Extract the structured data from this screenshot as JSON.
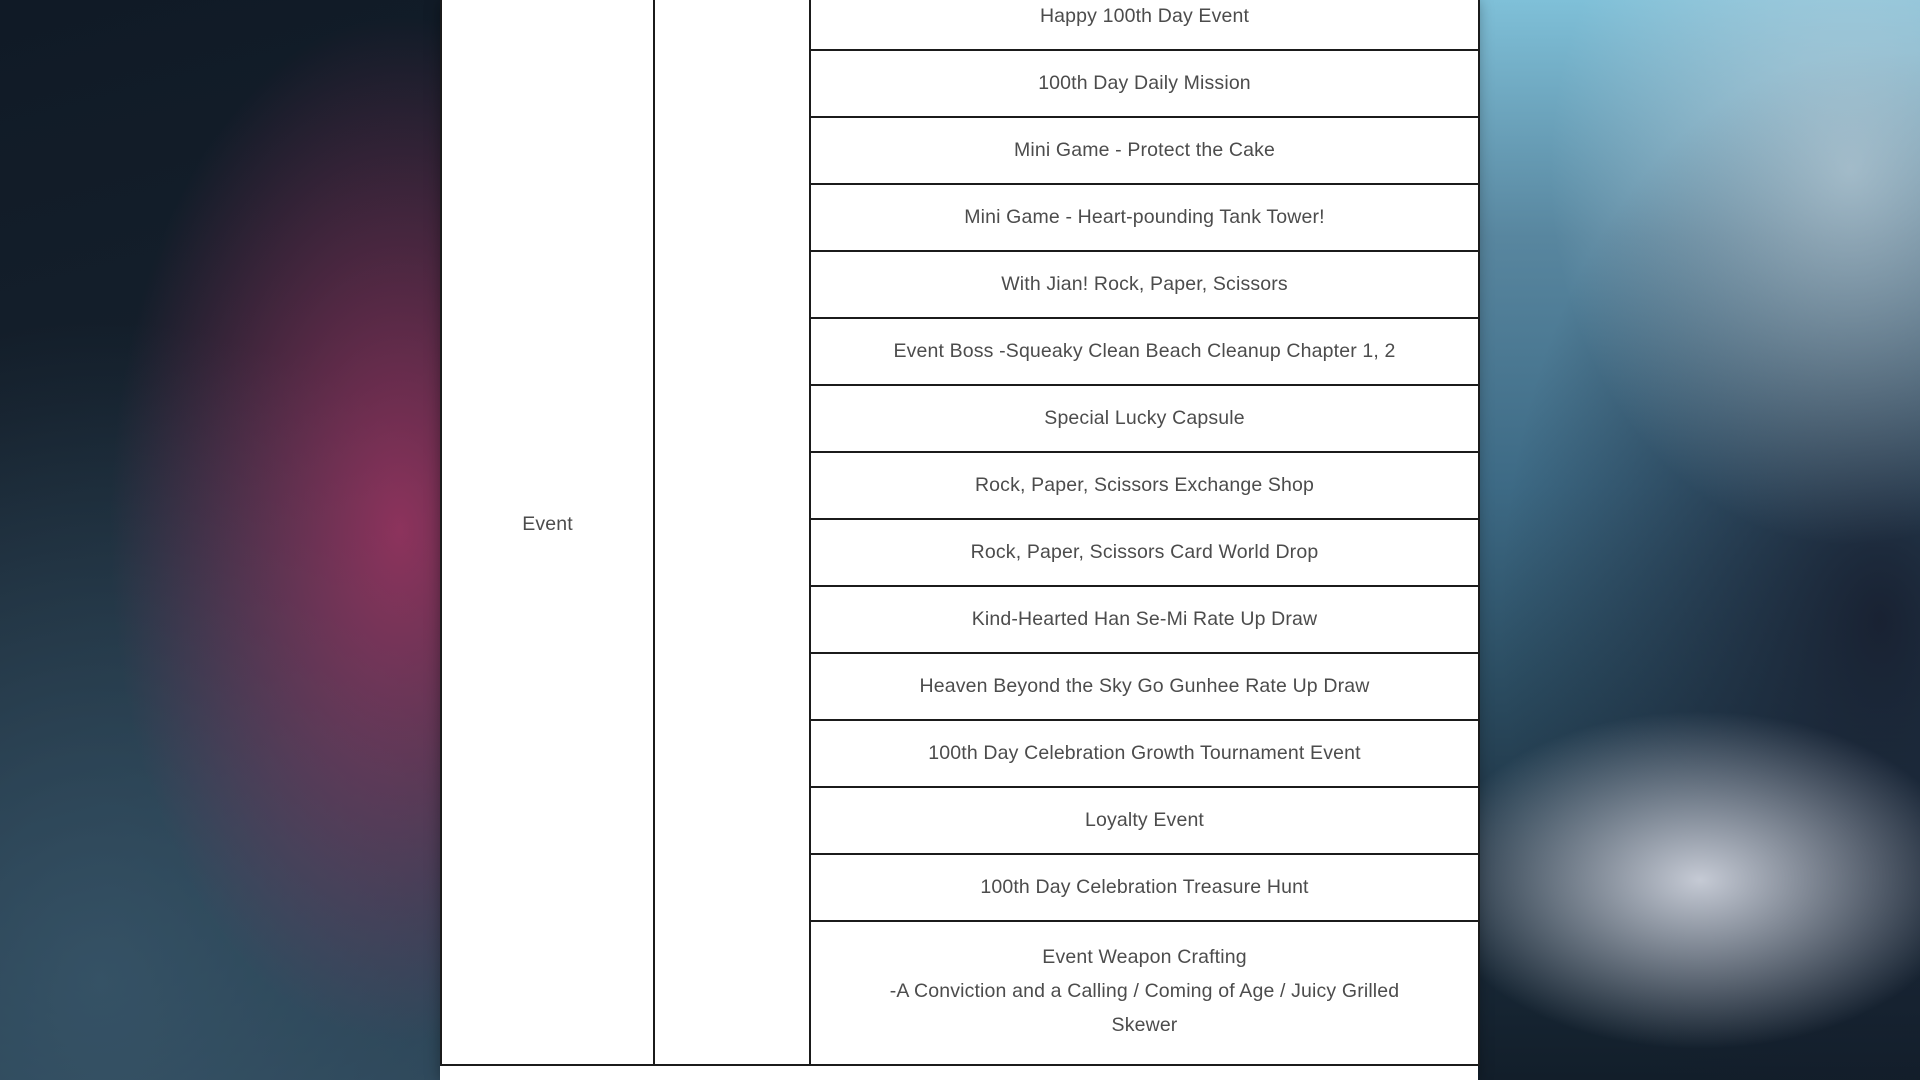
{
  "page": {
    "category_label": "Event",
    "background_left_color": "#141f2b",
    "background_right_color": "#3d6a85",
    "sheet_color": "#ffffff",
    "text_color": "#4c4c4c",
    "border_color": "#1b1b1b"
  },
  "table": {
    "rows": [
      {
        "text": "Happy 100th Day Event"
      },
      {
        "text": "100th Day Daily Mission"
      },
      {
        "text": "Mini Game - Protect the Cake"
      },
      {
        "text": "Mini Game - Heart-pounding Tank Tower!"
      },
      {
        "text": "With Jian! Rock, Paper, Scissors"
      },
      {
        "text": "Event Boss -Squeaky Clean Beach Cleanup Chapter 1, 2"
      },
      {
        "text": "Special Lucky Capsule"
      },
      {
        "text": "Rock, Paper, Scissors Exchange Shop"
      },
      {
        "text": "Rock, Paper, Scissors Card World Drop"
      },
      {
        "text": "Kind-Hearted Han Se-Mi Rate Up Draw"
      },
      {
        "text": "Heaven Beyond the Sky Go Gunhee Rate Up Draw"
      },
      {
        "text": "100th Day Celebration Growth Tournament Event"
      },
      {
        "text": "Loyalty Event"
      },
      {
        "text": "100th Day Celebration Treasure Hunt"
      },
      {
        "multiline": true,
        "lines": [
          "Event Weapon Crafting",
          "-A Conviction and a Calling / Coming of Age / Juicy Grilled",
          "Skewer"
        ]
      }
    ]
  }
}
